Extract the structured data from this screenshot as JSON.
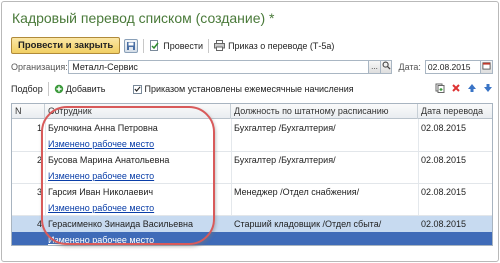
{
  "window": {
    "title": "Кадровый перевод списком (создание)",
    "modified_marker": "*"
  },
  "toolbar": {
    "post_close_label": "Провести и закрыть",
    "post_label": "Провести",
    "print_label": "Приказ о переводе (Т-5а)"
  },
  "form": {
    "org_label": "Организация:",
    "org_value": "Металл-Сервис",
    "select_button": "...",
    "date_label": "Дата:",
    "date_value": "02.08.2015"
  },
  "table_toolbar": {
    "pick_label": "Подбор",
    "add_label": "Добавить",
    "monthly_accruals_label": "Приказом установлены ежемесячные начисления",
    "monthly_accruals_checked": true
  },
  "table": {
    "columns": [
      "N",
      "Сотрудник",
      "Должность по штатному расписанию",
      "Дата перевода"
    ],
    "rows": [
      {
        "n": "1",
        "employee": "Булочкина Анна Петровна",
        "change": "Изменено рабочее место",
        "position": "Бухгалтер /Бухгалтерия/",
        "date": "02.08.2015"
      },
      {
        "n": "2",
        "employee": "Бусова Марина Анатольевна",
        "change": "Изменено рабочее место",
        "position": "Бухгалтер /Бухгалтерия/",
        "date": "02.08.2015"
      },
      {
        "n": "3",
        "employee": "Гарсия Иван Николаевич",
        "change": "Изменено рабочее место",
        "position": "Менеджер /Отдел снабжения/",
        "date": "02.08.2015"
      },
      {
        "n": "4",
        "employee": "Герасименко Зинаида Васильевна",
        "change": "Изменено рабочее место",
        "position": "Старший кладовщик /Отдел сбыта/",
        "date": "02.08.2015"
      }
    ],
    "selected_row": 4
  },
  "colors": {
    "title_green": "#4a7a3a",
    "primary_button": "#f1cf63",
    "selection": "#3f6bb8",
    "callout_red": "#d85a5a",
    "link_blue": "#0a3ea8"
  }
}
